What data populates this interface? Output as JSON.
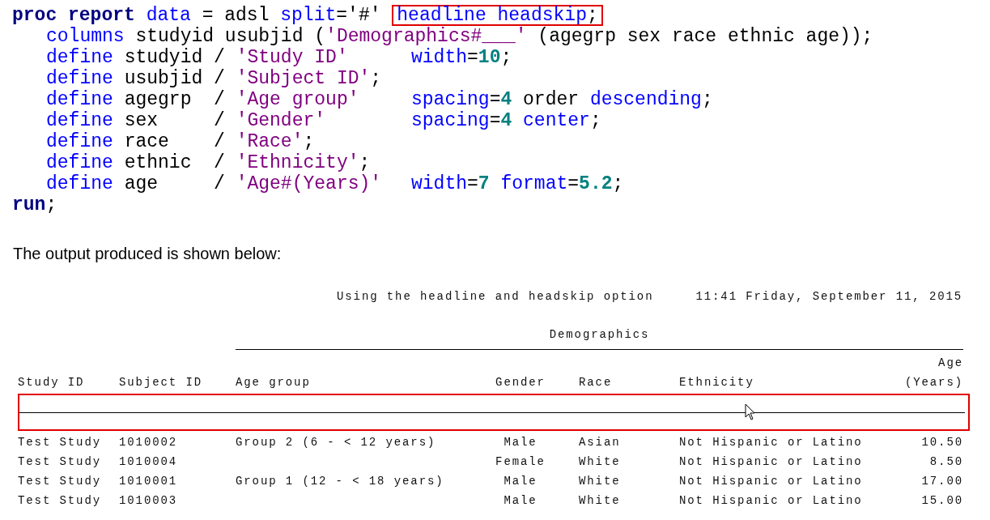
{
  "code": {
    "lines": [
      {
        "indented": false,
        "tokens": [
          {
            "kind": "keyword",
            "text": "proc report"
          },
          {
            "kind": "option",
            "text": " data"
          },
          {
            "kind": "plain",
            "text": " = adsl "
          },
          {
            "kind": "option",
            "text": "split"
          },
          {
            "kind": "plain",
            "text": "='#' "
          },
          {
            "kind": "highlight",
            "tokens": [
              {
                "kind": "option",
                "text": "headline headskip"
              },
              {
                "kind": "plain",
                "text": ";"
              }
            ]
          }
        ]
      },
      {
        "indented": true,
        "tokens": [
          {
            "kind": "option",
            "text": "columns"
          },
          {
            "kind": "plain",
            "text": " studyid usubjid ("
          },
          {
            "kind": "string",
            "text": "'Demographics#___'"
          },
          {
            "kind": "plain",
            "text": " (agegrp sex race ethnic age));"
          }
        ]
      },
      {
        "indented": true,
        "tokens": [
          {
            "kind": "option",
            "text": "define"
          },
          {
            "kind": "plain",
            "text": " studyid / "
          },
          {
            "kind": "string",
            "text": "'Study ID'"
          }
        ],
        "attributes": [
          {
            "kind": "option",
            "text": "width"
          },
          {
            "kind": "plain",
            "text": "="
          },
          {
            "kind": "number",
            "text": "10"
          },
          {
            "kind": "plain",
            "text": ";"
          }
        ]
      },
      {
        "indented": true,
        "tokens": [
          {
            "kind": "option",
            "text": "define"
          },
          {
            "kind": "plain",
            "text": " usubjid / "
          },
          {
            "kind": "string",
            "text": "'Subject ID'"
          },
          {
            "kind": "plain",
            "text": ";"
          }
        ]
      },
      {
        "indented": true,
        "tokens": [
          {
            "kind": "option",
            "text": "define"
          },
          {
            "kind": "plain",
            "text": " agegrp  / "
          },
          {
            "kind": "string",
            "text": "'Age group'"
          }
        ],
        "attributes": [
          {
            "kind": "option",
            "text": "spacing"
          },
          {
            "kind": "plain",
            "text": "="
          },
          {
            "kind": "number",
            "text": "4"
          },
          {
            "kind": "plain",
            "text": " order "
          },
          {
            "kind": "option",
            "text": "descending"
          },
          {
            "kind": "plain",
            "text": ";"
          }
        ]
      },
      {
        "indented": true,
        "tokens": [
          {
            "kind": "option",
            "text": "define"
          },
          {
            "kind": "plain",
            "text": " sex     / "
          },
          {
            "kind": "string",
            "text": "'Gender'"
          }
        ],
        "attributes": [
          {
            "kind": "option",
            "text": "spacing"
          },
          {
            "kind": "plain",
            "text": "="
          },
          {
            "kind": "number",
            "text": "4"
          },
          {
            "kind": "option",
            "text": " center"
          },
          {
            "kind": "plain",
            "text": ";"
          }
        ]
      },
      {
        "indented": true,
        "tokens": [
          {
            "kind": "option",
            "text": "define"
          },
          {
            "kind": "plain",
            "text": " race    / "
          },
          {
            "kind": "string",
            "text": "'Race'"
          },
          {
            "kind": "plain",
            "text": ";"
          }
        ]
      },
      {
        "indented": true,
        "tokens": [
          {
            "kind": "option",
            "text": "define"
          },
          {
            "kind": "plain",
            "text": " ethnic  / "
          },
          {
            "kind": "string",
            "text": "'Ethnicity'"
          },
          {
            "kind": "plain",
            "text": ";"
          }
        ]
      },
      {
        "indented": true,
        "tokens": [
          {
            "kind": "option",
            "text": "define"
          },
          {
            "kind": "plain",
            "text": " age     / "
          },
          {
            "kind": "string",
            "text": "'Age#(Years)'"
          }
        ],
        "attributes": [
          {
            "kind": "option",
            "text": "width"
          },
          {
            "kind": "plain",
            "text": "="
          },
          {
            "kind": "number",
            "text": "7"
          },
          {
            "kind": "option",
            "text": " format"
          },
          {
            "kind": "plain",
            "text": "="
          },
          {
            "kind": "number",
            "text": "5.2"
          },
          {
            "kind": "plain",
            "text": ";"
          }
        ]
      },
      {
        "indented": false,
        "tokens": [
          {
            "kind": "keyword",
            "text": "run"
          },
          {
            "kind": "plain",
            "text": ";"
          }
        ]
      }
    ]
  },
  "caption": "The output produced is shown below:",
  "report": {
    "title": "Using the headline and headskip option",
    "datetime": "11:41 Friday, September 11, 2015",
    "spanning_header": "Demographics",
    "headline_highlighted": true,
    "columns": [
      {
        "label_lines": [
          "Study ID"
        ]
      },
      {
        "label_lines": [
          "Subject ID"
        ]
      },
      {
        "label_lines": [
          "Age group"
        ]
      },
      {
        "label_lines": [
          "Gender"
        ]
      },
      {
        "label_lines": [
          "Race"
        ]
      },
      {
        "label_lines": [
          "Ethnicity"
        ]
      },
      {
        "label_lines": [
          "Age",
          "(Years)"
        ]
      }
    ],
    "rows": [
      {
        "study_id": "Test Study",
        "subject_id": "1010002",
        "age_group": "Group 2 (6 - < 12 years)",
        "gender": "Male",
        "race": "Asian",
        "ethnicity": "Not Hispanic or Latino",
        "age": "10.50"
      },
      {
        "study_id": "Test Study",
        "subject_id": "1010004",
        "gender": "Female",
        "race": "White",
        "ethnicity": "Not Hispanic or Latino",
        "age": "8.50"
      },
      {
        "study_id": "Test Study",
        "subject_id": "1010001",
        "age_group": "Group 1 (12 - < 18 years)",
        "gender": "Male",
        "race": "White",
        "ethnicity": "Not Hispanic or Latino",
        "age": "17.00"
      },
      {
        "study_id": "Test Study",
        "subject_id": "1010003",
        "gender": "Male",
        "race": "White",
        "ethnicity": "Not Hispanic or Latino",
        "age": "15.00"
      }
    ]
  }
}
